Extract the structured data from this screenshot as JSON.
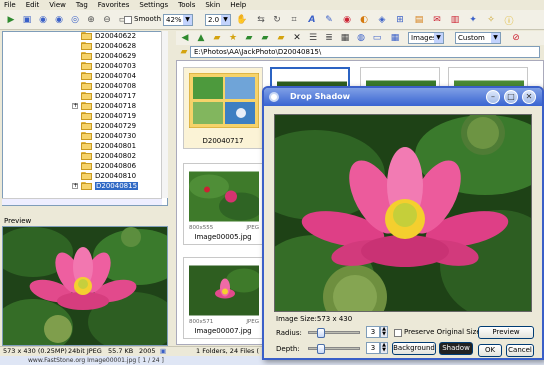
{
  "menu": [
    "File",
    "Edit",
    "View",
    "Tag",
    "Favorites",
    "Settings",
    "Tools",
    "Skin",
    "Help"
  ],
  "toolbar": {
    "smooth_label": "Smooth",
    "zoom_value": "42%",
    "step_value": "2.0"
  },
  "tree": {
    "folders": [
      "D20040622",
      "D20040628",
      "D20040629",
      "D20040703",
      "D20040704",
      "D20040708",
      "D20040717",
      "D20040718",
      "D20040719",
      "D20040729",
      "D20040730",
      "D20040801",
      "D20040802",
      "D20040806",
      "D20040810",
      "D20040815"
    ],
    "selected": "D20040815"
  },
  "preview": {
    "title": "Preview"
  },
  "browser": {
    "filter_value": "Images",
    "sort_value": "Custom Sort",
    "address": "E:\\Photos\\AA\\JackPhoto\\D20040815\\"
  },
  "thumbnails": [
    {
      "name": "D20040717",
      "dims": "",
      "type": ""
    },
    {
      "name": "Image00005.jpg",
      "dims": "800x555",
      "type": "JPEG"
    },
    {
      "name": "Image00007.jpg",
      "dims": "800x571",
      "type": "JPEG"
    }
  ],
  "dialog": {
    "title": "Drop Shadow",
    "image_size_label": "Image Size:573 x 430",
    "radius_label": "Radius:",
    "radius_value": "3",
    "depth_label": "Depth:",
    "depth_value": "3",
    "preserve_label": "Preserve Original Size",
    "preview_button": "Preview",
    "background_button": "Background",
    "shadow_button": "Shadow",
    "ok_button": "OK",
    "cancel_button": "Cancel"
  },
  "status": {
    "image_info": "573 x 430 (0.25MP)",
    "bit_depth": "24bit JPEG",
    "file_size": "55.7 KB",
    "year": "2005",
    "folder_info": "1 Folders, 24 Files (",
    "taskbar_text": "www.FastStone.org      Image00001.jpg [ 1 / 24 ]"
  },
  "colors": {
    "accent": "#316ac5",
    "dialog_title": "#3964d1",
    "lotus_pink": "#e8468f",
    "leaf_green": "#3e7a2a"
  }
}
